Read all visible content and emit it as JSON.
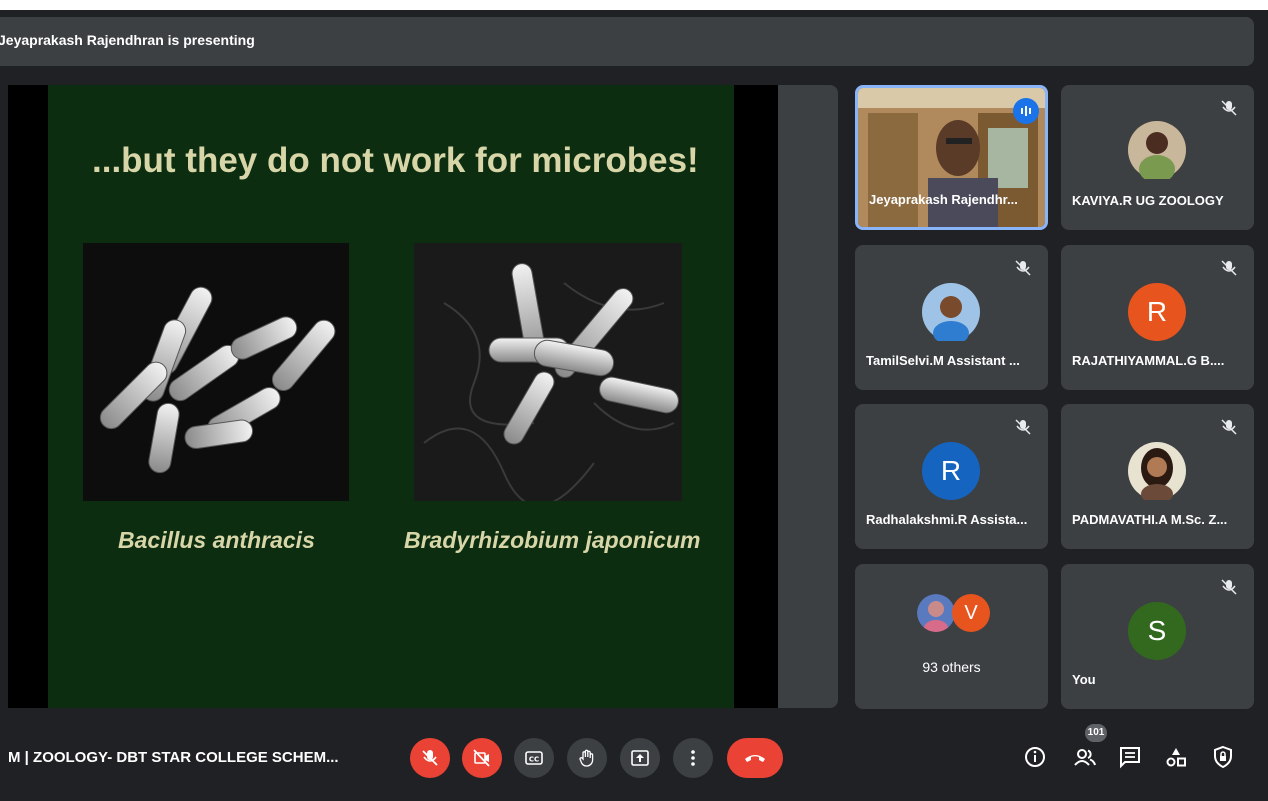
{
  "presenting": {
    "text": "Jeyaprakash Rajendhran is presenting"
  },
  "slide": {
    "title": "...but  they do not work for microbes!",
    "captions": [
      "Bacillus anthracis",
      "Bradyrhizobium japonicum"
    ]
  },
  "participants": [
    {
      "name": "Jeyaprakash Rajendhr...",
      "type": "video",
      "speaking": true
    },
    {
      "name": "KAVIYA.R UG ZOOLOGY",
      "type": "photo",
      "muted": true
    },
    {
      "name": "TamilSelvi.M Assistant ...",
      "type": "photo",
      "muted": true
    },
    {
      "name": "RAJATHIYAMMAL.G B....",
      "type": "initial",
      "initial": "R",
      "color": "#e8541e",
      "muted": true
    },
    {
      "name": "Radhalakshmi.R Assista...",
      "type": "initial",
      "initial": "R",
      "color": "#1565c0",
      "muted": true
    },
    {
      "name": "PADMAVATHI.A M.Sc. Z...",
      "type": "photo",
      "muted": true
    },
    {
      "name": "93 others",
      "type": "group",
      "initial": "V",
      "color": "#e8541e"
    },
    {
      "name": "You",
      "type": "initial",
      "initial": "S",
      "color": "#33691e",
      "muted": true
    }
  ],
  "controls": {
    "meeting_info": "M  |  ZOOLOGY- DBT STAR COLLEGE SCHEM...",
    "participant_count": "101",
    "buttons": [
      "mic-off",
      "camera-off",
      "captions",
      "raise-hand",
      "present",
      "more-options",
      "end-call"
    ],
    "right_icons": [
      "info",
      "people",
      "chat",
      "activities",
      "host-controls"
    ]
  },
  "colors": {
    "accent": "#8ab4f8",
    "danger": "#ea4335",
    "background": "#202124",
    "tile": "#3c4043"
  }
}
